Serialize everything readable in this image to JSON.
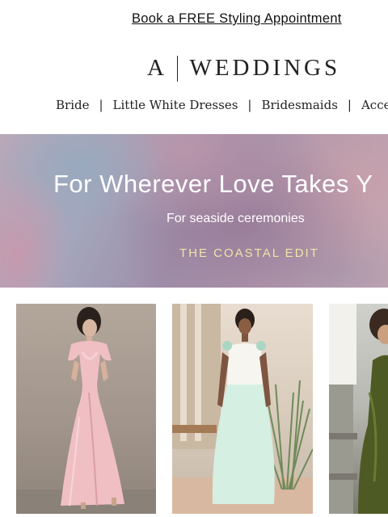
{
  "promo": {
    "label": "Book a FREE Styling Appointment"
  },
  "brand": {
    "left": "A",
    "right": "WEDDINGS"
  },
  "nav": {
    "separator": "|",
    "items": [
      {
        "label": "Bride"
      },
      {
        "label": "Little White Dresses"
      },
      {
        "label": "Bridesmaids"
      },
      {
        "label": "Acces"
      }
    ]
  },
  "hero": {
    "title": "For Wherever Love Takes Y",
    "subtitle": "For seaside ceremonies",
    "cta": "THE COASTAL EDIT"
  },
  "products": [
    {
      "image": "pink-satin-gown-photo"
    },
    {
      "image": "white-mint-drop-waist-gown-photo"
    },
    {
      "image": "olive-satin-dress-photo"
    }
  ]
}
